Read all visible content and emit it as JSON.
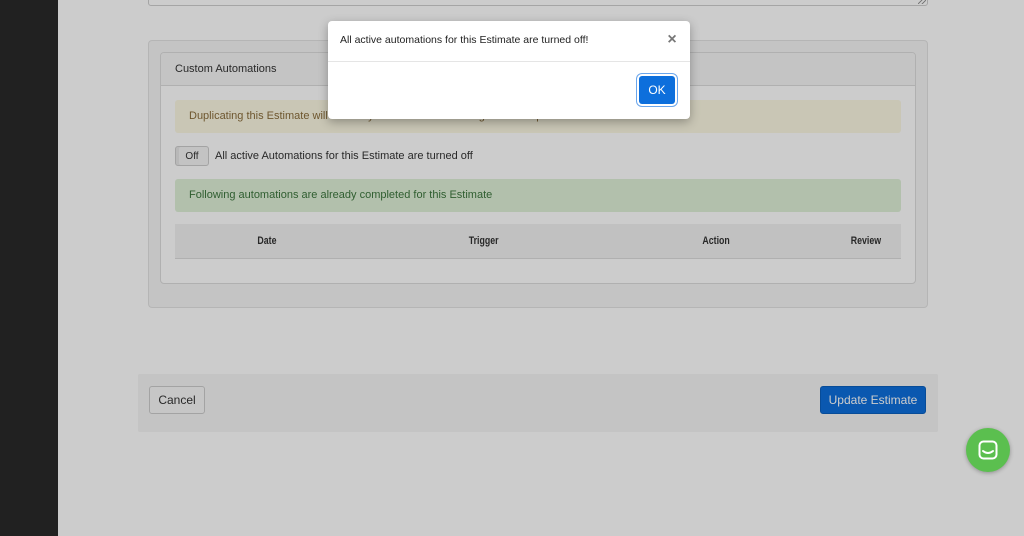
{
  "custom_automations": {
    "heading": "Custom Automations",
    "warning_text": "Duplicating this Estimate will not carry the automation settings to the duplicated Estimate.",
    "toggle": {
      "state_label": "Off"
    },
    "toggle_text": "All active Automations for this Estimate are turned off",
    "success_text": "Following automations are already completed for this Estimate",
    "table": {
      "columns": [
        "Date",
        "Trigger",
        "Action",
        "Review"
      ]
    }
  },
  "footer": {
    "cancel_label": "Cancel",
    "update_label": "Update Estimate"
  },
  "modal": {
    "title": "All active automations for this Estimate are turned off!",
    "close_glyph": "×",
    "ok_label": "OK"
  },
  "chat_widget": {
    "icon": "chat-icon",
    "color": "#5bbf4f"
  },
  "colors": {
    "primary": "#0d6fdc",
    "warning_bg": "#fcf8e3",
    "success_bg": "#dff0d8"
  }
}
